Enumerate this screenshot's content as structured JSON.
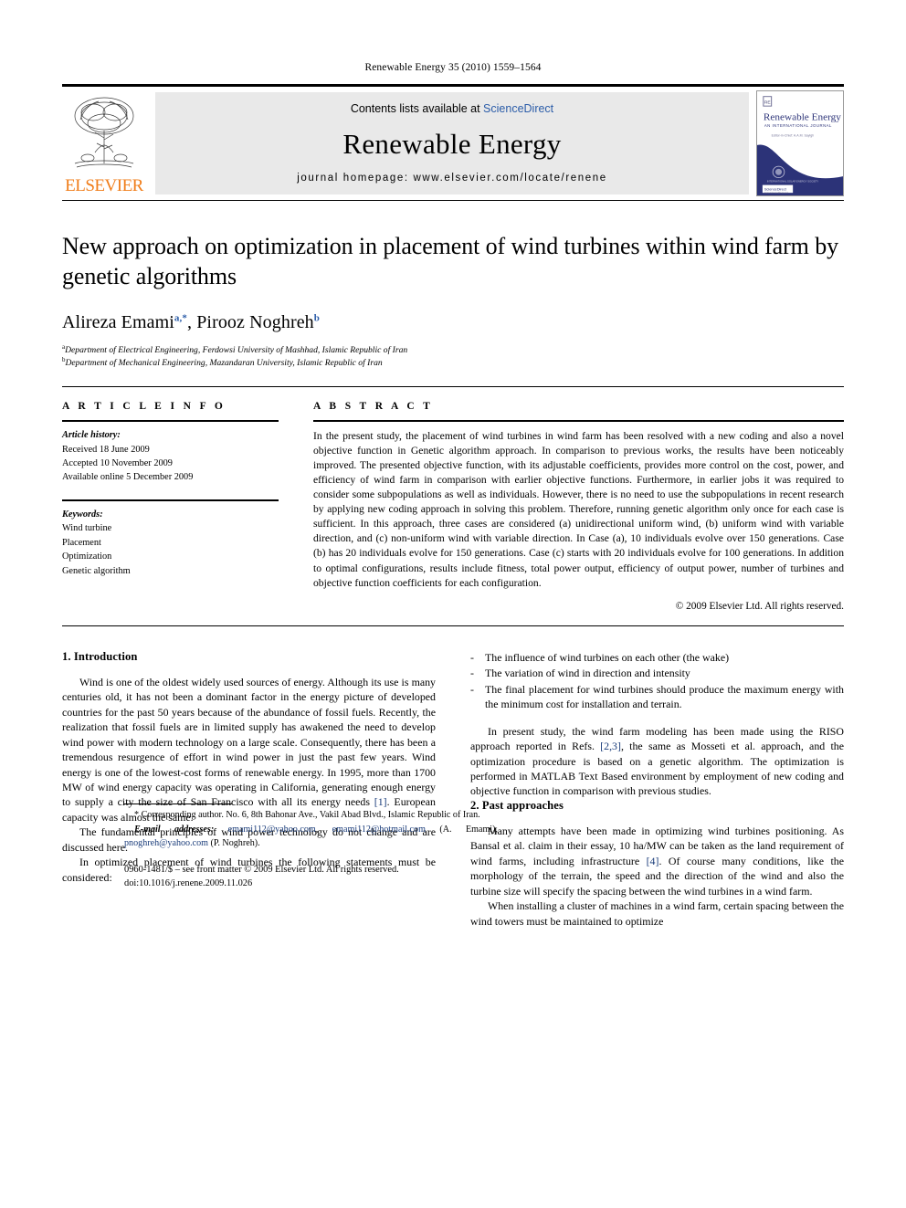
{
  "running_head": "Renewable Energy 35 (2010) 1559–1564",
  "masthead": {
    "publisher_word": "ELSEVIER",
    "contents_prefix": "Contents lists available at ",
    "contents_link": "ScienceDirect",
    "journal_name": "Renewable Energy",
    "homepage": "journal homepage: www.elsevier.com/locate/renene",
    "cover": {
      "title": "Renewable Energy",
      "subtitle": "AN INTERNATIONAL JOURNAL",
      "editors": "Editor-in-Chief: A.A.M. Sayigh",
      "footer": "ScienceDirect",
      "footer_url": "www.sciencedirect.com"
    }
  },
  "title": "New approach on optimization in placement of wind turbines within wind farm by genetic algorithms",
  "authors": {
    "a1_name": "Alireza Emami",
    "a1_sup": "a,*",
    "sep": ", ",
    "a2_name": "Pirooz Noghreh",
    "a2_sup": "b"
  },
  "affiliations": [
    {
      "marker": "a",
      "text": "Department of Electrical Engineering, Ferdowsi University of Mashhad, Islamic Republic of Iran"
    },
    {
      "marker": "b",
      "text": "Department of Mechanical Engineering, Mazandaran University, Islamic Republic of Iran"
    }
  ],
  "article_info": {
    "kicker": "A R T I C L E   I N F O",
    "history_label": "Article history:",
    "history": [
      "Received 18 June 2009",
      "Accepted 10 November 2009",
      "Available online 5 December 2009"
    ],
    "keywords_label": "Keywords:",
    "keywords": [
      "Wind turbine",
      "Placement",
      "Optimization",
      "Genetic algorithm"
    ]
  },
  "abstract": {
    "kicker": "A B S T R A C T",
    "text": "In the present study, the placement of wind turbines in wind farm has been resolved with a new coding and also a novel objective function in Genetic algorithm approach. In comparison to previous works, the results have been noticeably improved. The presented objective function, with its adjustable coefficients, provides more control on the cost, power, and efficiency of wind farm in comparison with earlier objective functions. Furthermore, in earlier jobs it was required to consider some subpopulations as well as individuals. However, there is no need to use the subpopulations in recent research by applying new coding approach in solving this problem. Therefore, running genetic algorithm only once for each case is sufficient. In this approach, three cases are considered (a) unidirectional uniform wind, (b) uniform wind with variable direction, and (c) non-uniform wind with variable direction. In Case (a), 10 individuals evolve over 150 generations. Case (b) has 20 individuals evolve for 150 generations. Case (c) starts with 20 individuals evolve for 100 generations. In addition to optimal configurations, results include fitness, total power output, efficiency of output power, number of turbines and objective function coefficients for each configuration.",
    "copyright": "© 2009 Elsevier Ltd. All rights reserved."
  },
  "sections": {
    "intro_heading": "1. Introduction",
    "intro_p1_a": "Wind is one of the oldest widely used sources of energy. Although its use is many centuries old, it has not been a dominant factor in the energy picture of developed countries for the past 50 years because of the abundance of fossil fuels. Recently, the realization that fossil fuels are in limited supply has awakened the need to develop wind power with modern technology on a large scale. Consequently, there has been a tremendous resurgence of effort in wind power in just the past few years. Wind energy is one of the lowest-cost forms of renewable energy. In 1995, more than 1700 MW of wind energy capacity was operating in California, generating enough energy to supply a city the size of San Francisco with all its energy needs ",
    "intro_p1_ref": "[1]",
    "intro_p1_b": ". European capacity was almost the same.",
    "intro_p2": "The fundamental principles of wind power technology do not change and are discussed here.",
    "intro_p3": "In optimized placement of wind turbines the following statements must be considered:",
    "bullets": [
      "The influence of wind turbines on each other (the wake)",
      "The variation of wind in direction and intensity",
      "The final placement for wind turbines should produce the maximum energy with the minimum cost for installation and terrain."
    ],
    "intro_p4_a": "In present study, the wind farm modeling has been made using the RISO approach reported in Refs. ",
    "intro_p4_ref": "[2,3]",
    "intro_p4_b": ", the same as Mosseti et al. approach, and the optimization procedure is based on a genetic algorithm. The optimization is performed in MATLAB Text Based environment by employment of new coding and objective function in comparison with previous studies.",
    "past_heading": "2. Past approaches",
    "past_p1_a": "Many attempts have been made in optimizing wind turbines positioning. As Bansal et al. claim in their essay, 10 ha/MW can be taken as the land requirement of wind farms, including infrastructure ",
    "past_p1_ref": "[4]",
    "past_p1_b": ". Of course many conditions, like the morphology of the terrain, the speed and the direction of the wind and also the turbine size will specify the spacing between the wind turbines in a wind farm.",
    "past_p2": "When installing a cluster of machines in a wind farm, certain spacing between the wind towers must be maintained to optimize"
  },
  "footnote": {
    "corresponding": "* Corresponding author. No. 6, 8th Bahonar Ave., Vakil Abad Blvd., Islamic Republic of Iran.",
    "email_label": "E-mail addresses:",
    "email_1": "emami112@yahoo.com",
    "email_sep": ", ",
    "email_2": "emami112@hotmail.com",
    "email_1_owner": " (A. Emami), ",
    "email_3": "pnoghreh@yahoo.com",
    "email_3_owner": " (P. Noghreh)."
  },
  "imprint": {
    "line1": "0960-1481/$ – see front matter © 2009 Elsevier Ltd. All rights reserved.",
    "line2": "doi:10.1016/j.renene.2009.11.026"
  },
  "colors": {
    "link_blue": "#2b5ca8",
    "ref_blue": "#1a3c7a",
    "elsevier_orange": "#f07d1a",
    "band_grey": "#e9e9e9",
    "cover_navy": "#2c3378",
    "cover_gold": "#e8b629"
  }
}
